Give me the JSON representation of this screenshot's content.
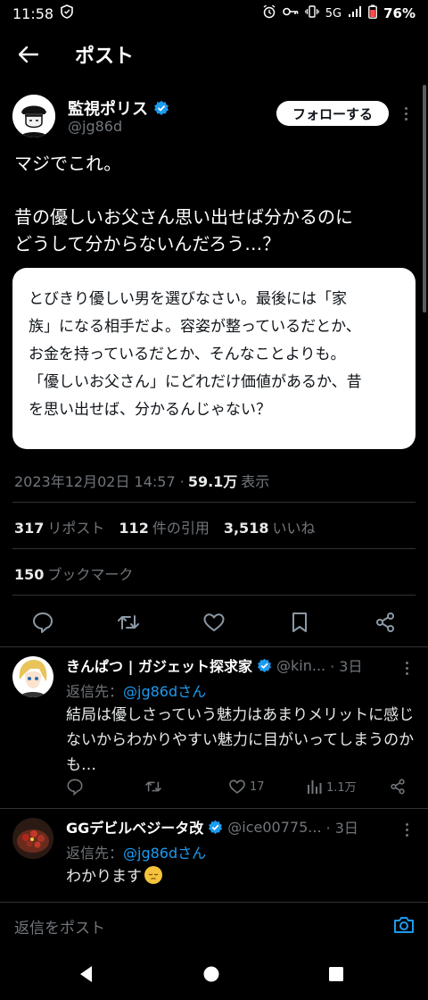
{
  "status_bar": {
    "time": "11:58",
    "network": "5G",
    "battery": "76%"
  },
  "header": {
    "title": "ポスト"
  },
  "post": {
    "author_name": "監視ポリス",
    "author_handle": "@jg86d",
    "follow_label": "フォローする",
    "text": "マジでこれ。\n\n昔の優しいお父さん思い出せば分かるのに\nどうして分からないんだろう…？",
    "quote_lines": [
      "とびきり優しい男を選びなさい。最後には「家",
      "族」になる相手だよ。容姿が整っているだとか、",
      "お金を持っているだとか、そんなことよりも。",
      "「優しいお父さん」にどれだけ価値があるか、昔",
      "を思い出せば、分かるんじゃない？"
    ],
    "timestamp": "2023年12月02日 14:57 · ",
    "views_count": "59.1万",
    "views_label": "表示",
    "reposts_count": "317",
    "reposts_label": "リポスト",
    "quotes_count": "112",
    "quotes_label": "件の引用",
    "likes_count": "3,518",
    "likes_label": "いいね",
    "bookmarks_count": "150",
    "bookmarks_label": "ブックマーク"
  },
  "replies": [
    {
      "name": "きんぱつ | ガジェット探求家",
      "handle": "@kin...",
      "time": "· 3日",
      "reply_to_label": "返信先：",
      "reply_to_mention": "@jg86dさん",
      "text": "結局は優しさっていう魅力はあまりメリットに感じないからわかりやすい魅力に目がいってしまうのかも…",
      "likes": "17",
      "views": "1.1万"
    },
    {
      "name": "GGデビルベジータ改",
      "handle": "@ice00775...",
      "time": "· 3日",
      "reply_to_label": "返信先：",
      "reply_to_mention": "@jg86dさん",
      "text": "わかります"
    }
  ],
  "compose": {
    "placeholder": "返信をポスト"
  },
  "colors": {
    "accent": "#1d9bf0",
    "muted": "#71767b",
    "background": "#000000"
  }
}
